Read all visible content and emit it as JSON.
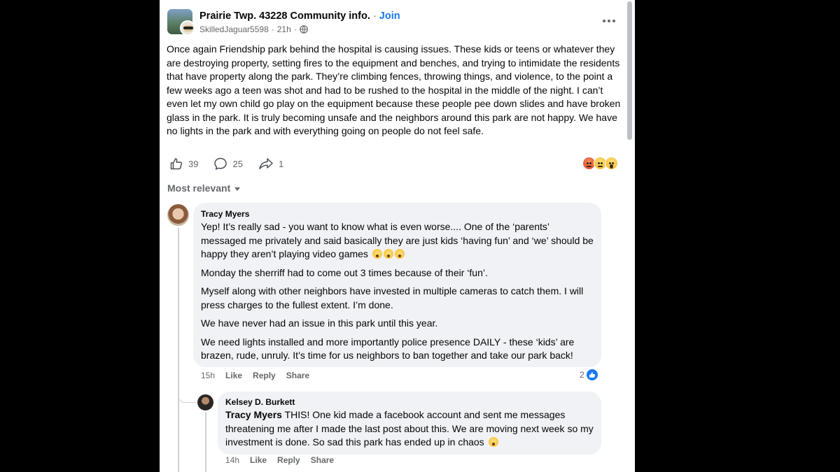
{
  "post": {
    "group_name": "Prairie Twp. 43228 Community info.",
    "separator": "·",
    "join_label": "Join",
    "author": "SkilledJaguar5598",
    "time": "21h",
    "meta_separator": "·",
    "privacy_icon": "globe-icon",
    "more_icon": "more-horizontal-icon",
    "body": "Once again Friendship park behind the hospital is causing issues. These kids or teens or whatever they are destroying property, setting fires to the equipment and benches, and trying to intimidate the residents that have property along the park. They’re climbing fences, throwing things, and violence, to the point a few weeks ago a teen was shot and had to be rushed to the hospital in the middle of the night. I can’t even let my own child go play on the equipment because these people pee down slides and have broken glass in the park. It is truly becoming unsafe and the neighbors around this park are not happy. We have no lights in the park and with everything going on people do not feel safe.",
    "likes": "39",
    "comments": "25",
    "shares": "1",
    "reactions": [
      "angry",
      "sad",
      "wow"
    ]
  },
  "sort_label": "Most relevant",
  "comments": [
    {
      "author": "Tracy Myers",
      "paragraphs": [
        "Yep! It’s really sad - you want to know what is even worse.... One of the ‘parents’ messaged me privately and said basically they are just kids ‘having fun’ and ‘we’ should be happy they aren’t playing video games",
        "Monday the sherriff had to come out 3 times because of their ‘fun’.",
        "Myself along with other neighbors have invested in multiple cameras to catch them. I will press charges to the fullest extent. I’m done.",
        "We have never had an issue in this park until this year.",
        "We need lights installed and more importantly police presence DAILY - these ‘kids’ are brazen, rude, unruly. It’s time for us neighbors to ban together and take our park back!"
      ],
      "time": "15h",
      "like_label": "Like",
      "reply_label": "Reply",
      "share_label": "Share",
      "reaction_count": "2"
    },
    {
      "author": "Kelsey D. Burkett",
      "mention": "Tracy Myers",
      "text": " THIS! One kid made a facebook account and sent me messages threatening me after I made the last post about this. We are moving next week so my investment is done. So sad this park has ended up in chaos",
      "time": "14h",
      "like_label": "Like",
      "reply_label": "Reply",
      "share_label": "Share"
    }
  ]
}
